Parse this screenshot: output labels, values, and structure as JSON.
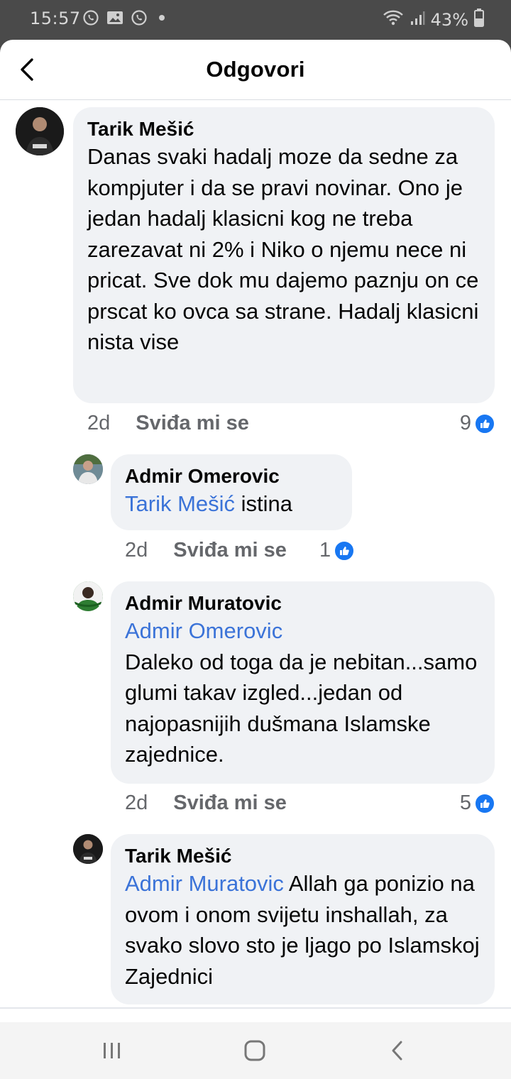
{
  "status_bar": {
    "time": "15:57",
    "battery": "43%"
  },
  "header": {
    "title": "Odgovori"
  },
  "comments": [
    {
      "author": "Tarik Mešić",
      "mention": "",
      "text": "Danas svaki hadalj moze da sedne za kompjuter i da se pravi novinar. Ono je jedan hadalj klasicni kog ne treba zarezavat ni 2% i Niko o njemu nece ni pricat. Sve dok mu dajemo paznju on ce prscat ko ovca sa strane. Hadalj klasicni nista vise",
      "time": "2d",
      "like_label": "Sviđa mi se",
      "reactions": "9"
    },
    {
      "author": "Admir Omerovic",
      "mention": "Tarik Mešić",
      "text": " istina",
      "time": "2d",
      "like_label": "Sviđa mi se",
      "reactions": "1"
    },
    {
      "author": "Admir Muratovic",
      "mention": "Admir Omerovic",
      "text": "Daleko od toga da je nebitan...samo glumi takav izgled...jedan od najopasnijih dušmana Islamske zajednice.",
      "time": "2d",
      "like_label": "Sviđa mi se",
      "reactions": "5"
    },
    {
      "author": "Tarik Mešić",
      "mention": "Admir Muratovic",
      "text": " Allah ga ponizio na ovom i onom svijetu inshallah, za svako slovo sto je ljago po Islamskoj Zajednici",
      "time": "",
      "like_label": "",
      "reactions": ""
    }
  ],
  "colors": {
    "mention": "#3b73d8",
    "like_badge": "#1877f2",
    "bubble": "#f0f2f5"
  },
  "icons": [
    "whatsapp-icon",
    "gallery-icon",
    "wifi-icon",
    "signal-icon",
    "battery-icon",
    "back-arrow-icon",
    "like-icon",
    "recents-icon",
    "home-icon",
    "nav-back-icon"
  ]
}
